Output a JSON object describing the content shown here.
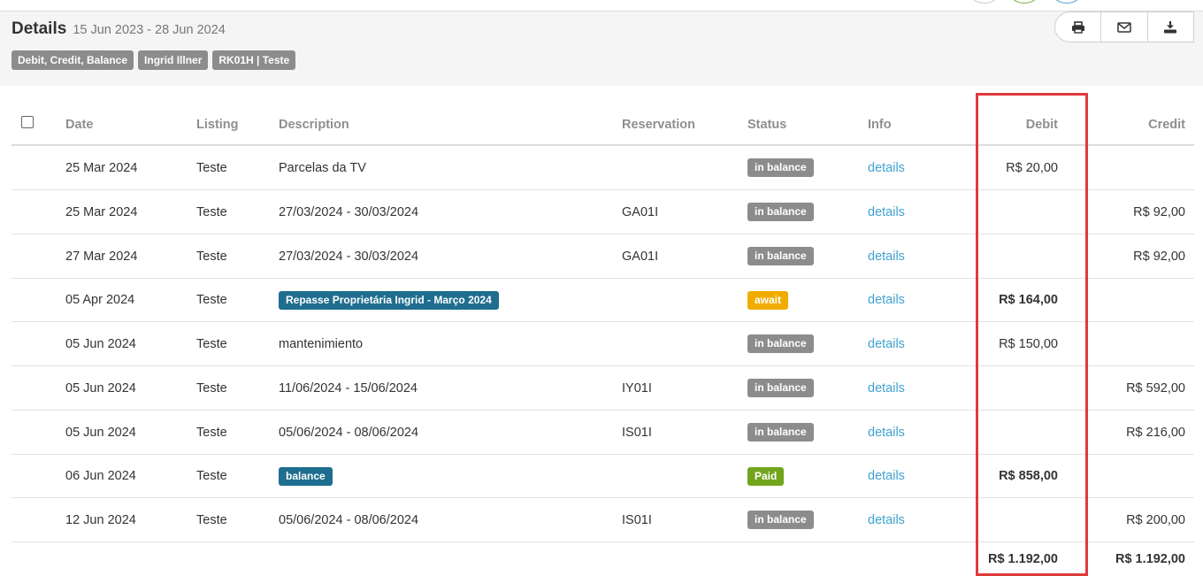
{
  "header": {
    "title": "Details",
    "date_range": "15 Jun 2023 - 28 Jun 2024",
    "tags": [
      "Debit, Credit, Balance",
      "Ingrid Illner",
      "RK01H | Teste"
    ],
    "actions": [
      {
        "name": "print-button",
        "icon": "printer-icon"
      },
      {
        "name": "email-button",
        "icon": "envelope-icon"
      },
      {
        "name": "download-button",
        "icon": "download-icon"
      }
    ]
  },
  "table": {
    "columns": {
      "date": "Date",
      "listing": "Listing",
      "description": "Description",
      "reservation": "Reservation",
      "status": "Status",
      "info": "Info",
      "debit": "Debit",
      "credit": "Credit"
    },
    "rows": [
      {
        "date": "25 Mar 2024",
        "listing": "Teste",
        "description": "Parcelas da TV",
        "desc_is_label": false,
        "reservation": "",
        "status": "in balance",
        "status_kind": "balance",
        "info": "details",
        "debit": "R$ 20,00",
        "debit_bold": false,
        "credit": ""
      },
      {
        "date": "25 Mar 2024",
        "listing": "Teste",
        "description": "27/03/2024 - 30/03/2024",
        "desc_is_label": false,
        "reservation": "GA01I",
        "status": "in balance",
        "status_kind": "balance",
        "info": "details",
        "debit": "",
        "debit_bold": false,
        "credit": "R$ 92,00"
      },
      {
        "date": "27 Mar 2024",
        "listing": "Teste",
        "description": "27/03/2024 - 30/03/2024",
        "desc_is_label": false,
        "reservation": "GA01I",
        "status": "in balance",
        "status_kind": "balance",
        "info": "details",
        "debit": "",
        "debit_bold": false,
        "credit": "R$ 92,00"
      },
      {
        "date": "05 Apr 2024",
        "listing": "Teste",
        "description": "Repasse Proprietária Ingrid - Março 2024",
        "desc_is_label": true,
        "reservation": "",
        "status": "await",
        "status_kind": "await",
        "info": "details",
        "debit": "R$ 164,00",
        "debit_bold": true,
        "credit": ""
      },
      {
        "date": "05 Jun 2024",
        "listing": "Teste",
        "description": "mantenimiento",
        "desc_is_label": false,
        "reservation": "",
        "status": "in balance",
        "status_kind": "balance",
        "info": "details",
        "debit": "R$ 150,00",
        "debit_bold": false,
        "credit": ""
      },
      {
        "date": "05 Jun 2024",
        "listing": "Teste",
        "description": "11/06/2024 - 15/06/2024",
        "desc_is_label": false,
        "reservation": "IY01I",
        "status": "in balance",
        "status_kind": "balance",
        "info": "details",
        "debit": "",
        "debit_bold": false,
        "credit": "R$ 592,00"
      },
      {
        "date": "05 Jun 2024",
        "listing": "Teste",
        "description": "05/06/2024 - 08/06/2024",
        "desc_is_label": false,
        "reservation": "IS01I",
        "status": "in balance",
        "status_kind": "balance",
        "info": "details",
        "debit": "",
        "debit_bold": false,
        "credit": "R$ 216,00"
      },
      {
        "date": "06 Jun 2024",
        "listing": "Teste",
        "description": "balance",
        "desc_is_label": true,
        "reservation": "",
        "status": "Paid",
        "status_kind": "paid",
        "info": "details",
        "debit": "R$ 858,00",
        "debit_bold": true,
        "credit": ""
      },
      {
        "date": "12 Jun 2024",
        "listing": "Teste",
        "description": "05/06/2024 - 08/06/2024",
        "desc_is_label": false,
        "reservation": "IS01I",
        "status": "in balance",
        "status_kind": "balance",
        "info": "details",
        "debit": "",
        "debit_bold": false,
        "credit": "R$ 200,00"
      }
    ],
    "totals": {
      "debit": "R$ 1.192,00",
      "credit": "R$ 1.192,00"
    }
  },
  "colors": {
    "header_bg": "#f5f5f5",
    "tag_gray": "#8c8c8c",
    "label_blue": "#1f6e8f",
    "await_yellow": "#f0ad00",
    "paid_green": "#72a51d",
    "link_blue": "#3fa3cf",
    "highlight_red": "#e0393c"
  }
}
